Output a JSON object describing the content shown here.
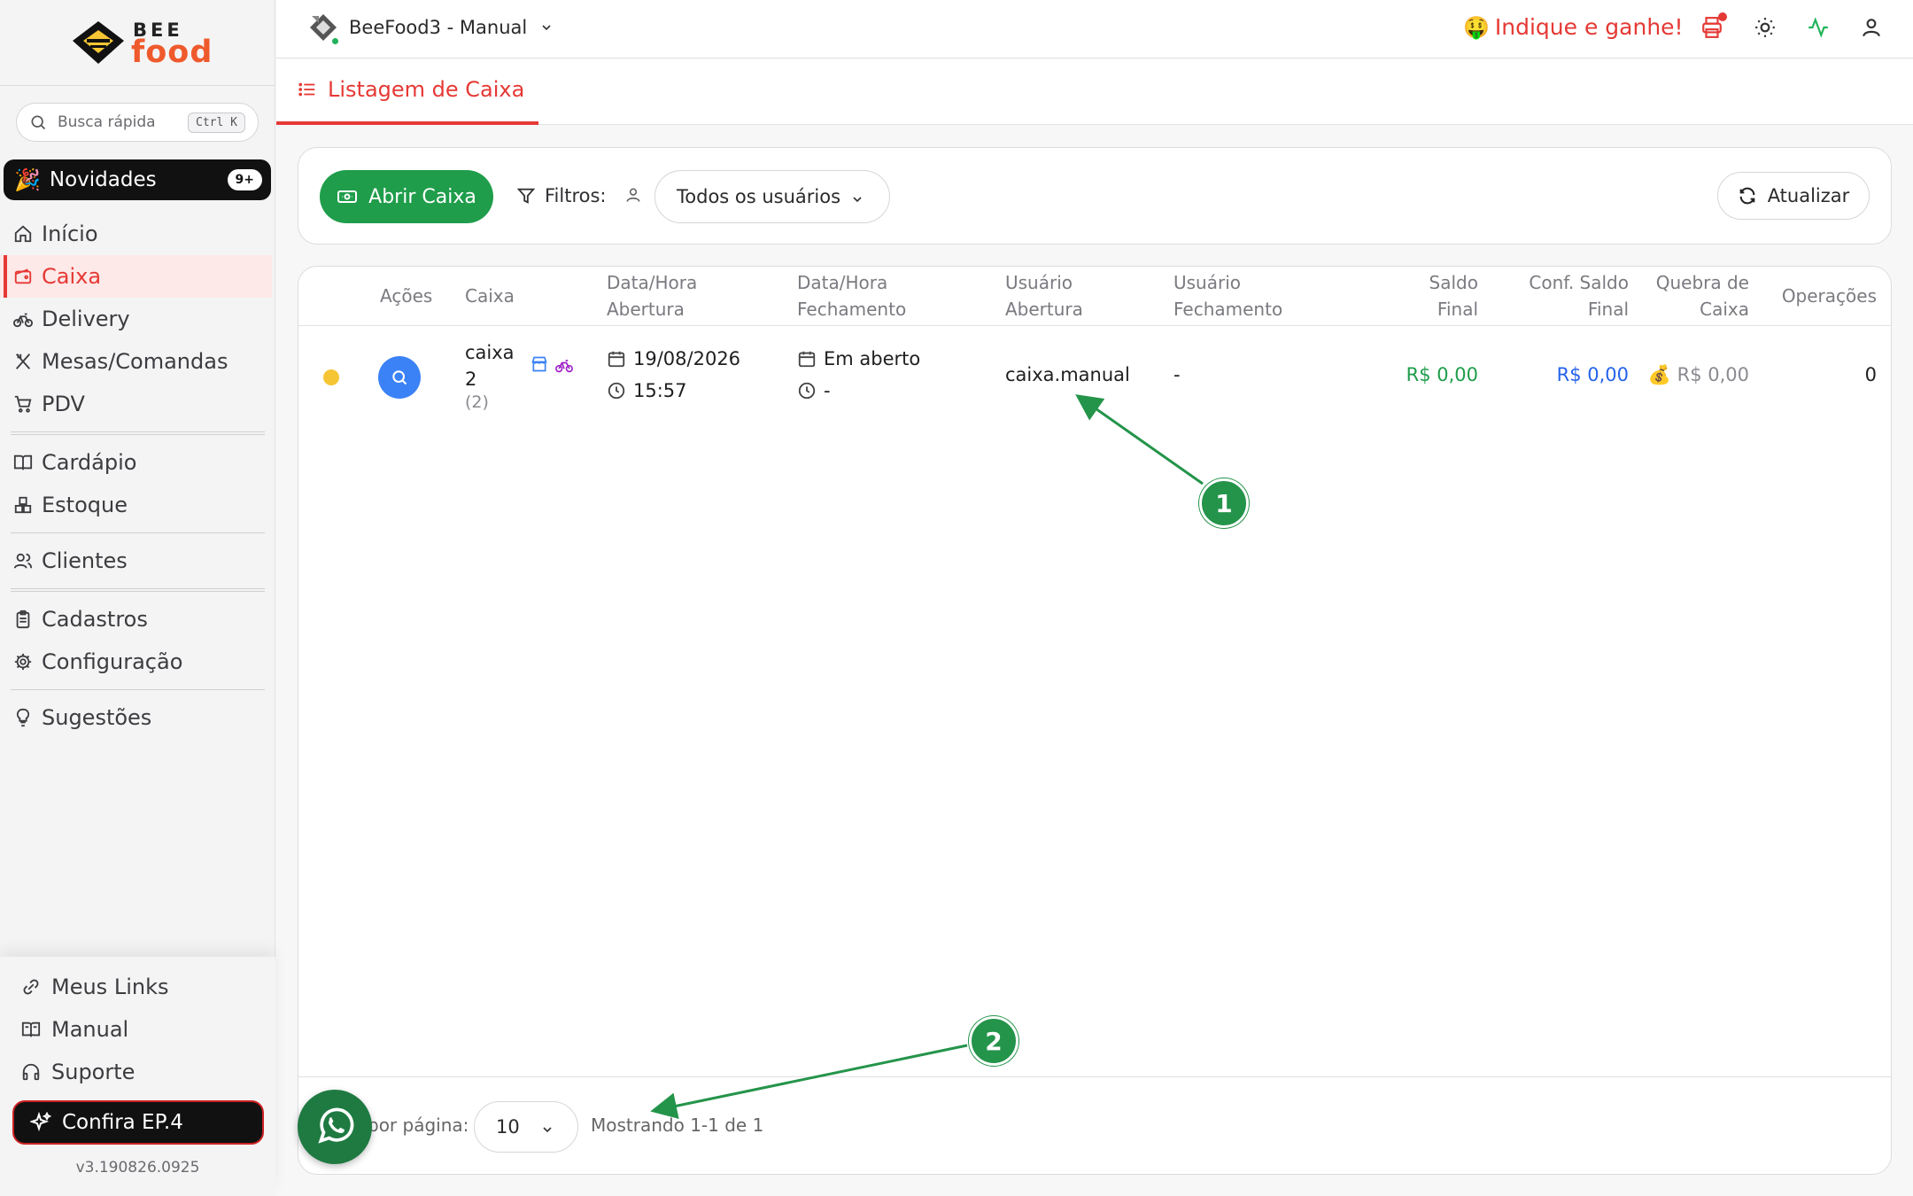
{
  "brand": {
    "logo_top": "BEE",
    "logo_bottom": "food"
  },
  "search": {
    "placeholder": "Busca rápida",
    "shortcut": "Ctrl K"
  },
  "news": {
    "emoji": "🎉",
    "label": "Novidades",
    "badge": "9+"
  },
  "sidebar": {
    "items": [
      {
        "label": "Início",
        "icon": "home-icon"
      },
      {
        "label": "Caixa",
        "icon": "wallet-icon",
        "active": true
      },
      {
        "label": "Delivery",
        "icon": "bike-icon"
      },
      {
        "label": "Mesas/Comandas",
        "icon": "utensils-icon"
      },
      {
        "label": "PDV",
        "icon": "cart-icon"
      },
      {
        "label": "Cardápio",
        "icon": "book-open-icon"
      },
      {
        "label": "Estoque",
        "icon": "boxes-icon"
      },
      {
        "label": "Clientes",
        "icon": "users-icon"
      },
      {
        "label": "Cadastros",
        "icon": "clipboard-icon"
      },
      {
        "label": "Configuração",
        "icon": "gear-icon"
      },
      {
        "label": "Sugestões",
        "icon": "lightbulb-icon"
      }
    ],
    "bottom": [
      {
        "label": "Meus Links",
        "icon": "link-icon"
      },
      {
        "label": "Manual",
        "icon": "book-icon"
      },
      {
        "label": "Suporte",
        "icon": "headphones-icon"
      }
    ],
    "confira": "Confira EP.4",
    "version": "v3.190826.0925"
  },
  "topbar": {
    "company": "BeeFood3 - Manual",
    "indique_emoji": "🤑",
    "indique": "Indique e ganhe!",
    "icons": [
      "printer-icon",
      "sun-icon",
      "activity-icon",
      "user-icon"
    ]
  },
  "page": {
    "tab_title": "Listagem de Caixa"
  },
  "filters": {
    "open_button": "Abrir Caixa",
    "label": "Filtros:",
    "users_select": "Todos os usuários",
    "refresh_button": "Atualizar"
  },
  "table": {
    "headers": {
      "acoes": "Ações",
      "caixa": "Caixa",
      "abertura_1": "Data/Hora",
      "abertura_2": "Abertura",
      "fechamento_1": "Data/Hora",
      "fechamento_2": "Fechamento",
      "usr_abertura_1": "Usuário",
      "usr_abertura_2": "Abertura",
      "usr_fechamento_1": "Usuário",
      "usr_fechamento_2": "Fechamento",
      "saldo_1": "Saldo",
      "saldo_2": "Final",
      "conf_1": "Conf. Saldo",
      "conf_2": "Final",
      "quebra_1": "Quebra de",
      "quebra_2": "Caixa",
      "operacoes": "Operações"
    },
    "rows": [
      {
        "caixa_line1": "caixa",
        "caixa_line2": "2",
        "caixa_count": "(2)",
        "open_date": "19/08/2026",
        "open_time": "15:57",
        "close_date": "Em aberto",
        "close_time": "-",
        "user_open": "caixa.manual",
        "user_close": "-",
        "saldo_final": "R$ 0,00",
        "conf_saldo": "R$ 0,00",
        "quebra_emoji": "💰",
        "quebra": "R$ 0,00",
        "operacoes": "0"
      }
    ],
    "footer": {
      "per_page_label": "por página:",
      "per_page": "10",
      "showing": "Mostrando 1-1 de 1"
    }
  },
  "annotations": {
    "marker1": "1",
    "marker2": "2"
  },
  "colors": {
    "accent": "#e53935",
    "green": "#1f9d4b",
    "blue": "#3b82f6",
    "status_open": "#f5c534"
  }
}
